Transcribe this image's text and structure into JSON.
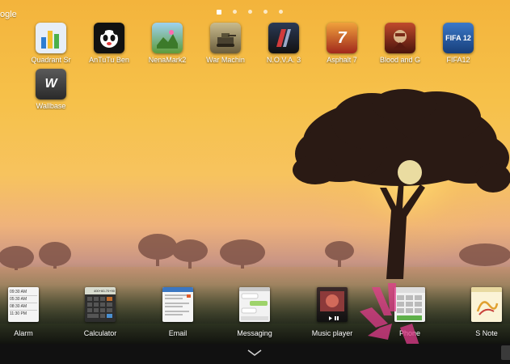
{
  "status": {
    "google_label": "ogle"
  },
  "page_indicator": {
    "count": 5,
    "active": 0
  },
  "home_apps": [
    {
      "label": "Quadrant Sr",
      "icon": "bar-chart-icon",
      "bg": "#2d7dd2"
    },
    {
      "label": "AnTuTu Ben",
      "icon": "antutu-panda-icon",
      "bg": "#111111"
    },
    {
      "label": "NenaMark2",
      "icon": "nenamark-icon",
      "bg": "#5d9b3a"
    },
    {
      "label": "War Machin",
      "icon": "war-machine-icon",
      "bg": "#8a7a55"
    },
    {
      "label": "N.O.V.A. 3",
      "icon": "nova3-icon",
      "bg": "#3a3a46"
    },
    {
      "label": "Asphalt 7",
      "icon": "asphalt7-icon",
      "bg": "#d9512c"
    },
    {
      "label": "Blood and G",
      "icon": "blood-glory-icon",
      "bg": "#8c2a1a"
    },
    {
      "label": "FIFA12",
      "icon": "fifa12-icon",
      "bg": "#1e5aa8"
    },
    {
      "label": "Wallbase",
      "icon": "wallbase-icon",
      "bg": "#3c3c3c"
    }
  ],
  "icon_text": {
    "wallbase": "W",
    "asphalt": "7",
    "fifa": "FIFA 12"
  },
  "tray_items": [
    {
      "label": "Alarm",
      "icon": "alarm-widget-icon"
    },
    {
      "label": "Calculator",
      "icon": "calculator-widget-icon"
    },
    {
      "label": "Email",
      "icon": "email-widget-icon"
    },
    {
      "label": "Messaging",
      "icon": "messaging-widget-icon"
    },
    {
      "label": "Music player",
      "icon": "music-player-widget-icon"
    },
    {
      "label": "Phone",
      "icon": "phone-widget-icon"
    },
    {
      "label": "S Note",
      "icon": "s-note-widget-icon"
    }
  ],
  "alarm_times": [
    "09:30 AM",
    "05:30 AM",
    "08:30 AM",
    "11:30 PM"
  ],
  "calculator_display": "400+60-70+90",
  "colors": {
    "accent_pink": "#e23c8c",
    "tray_bg": "#101010"
  }
}
